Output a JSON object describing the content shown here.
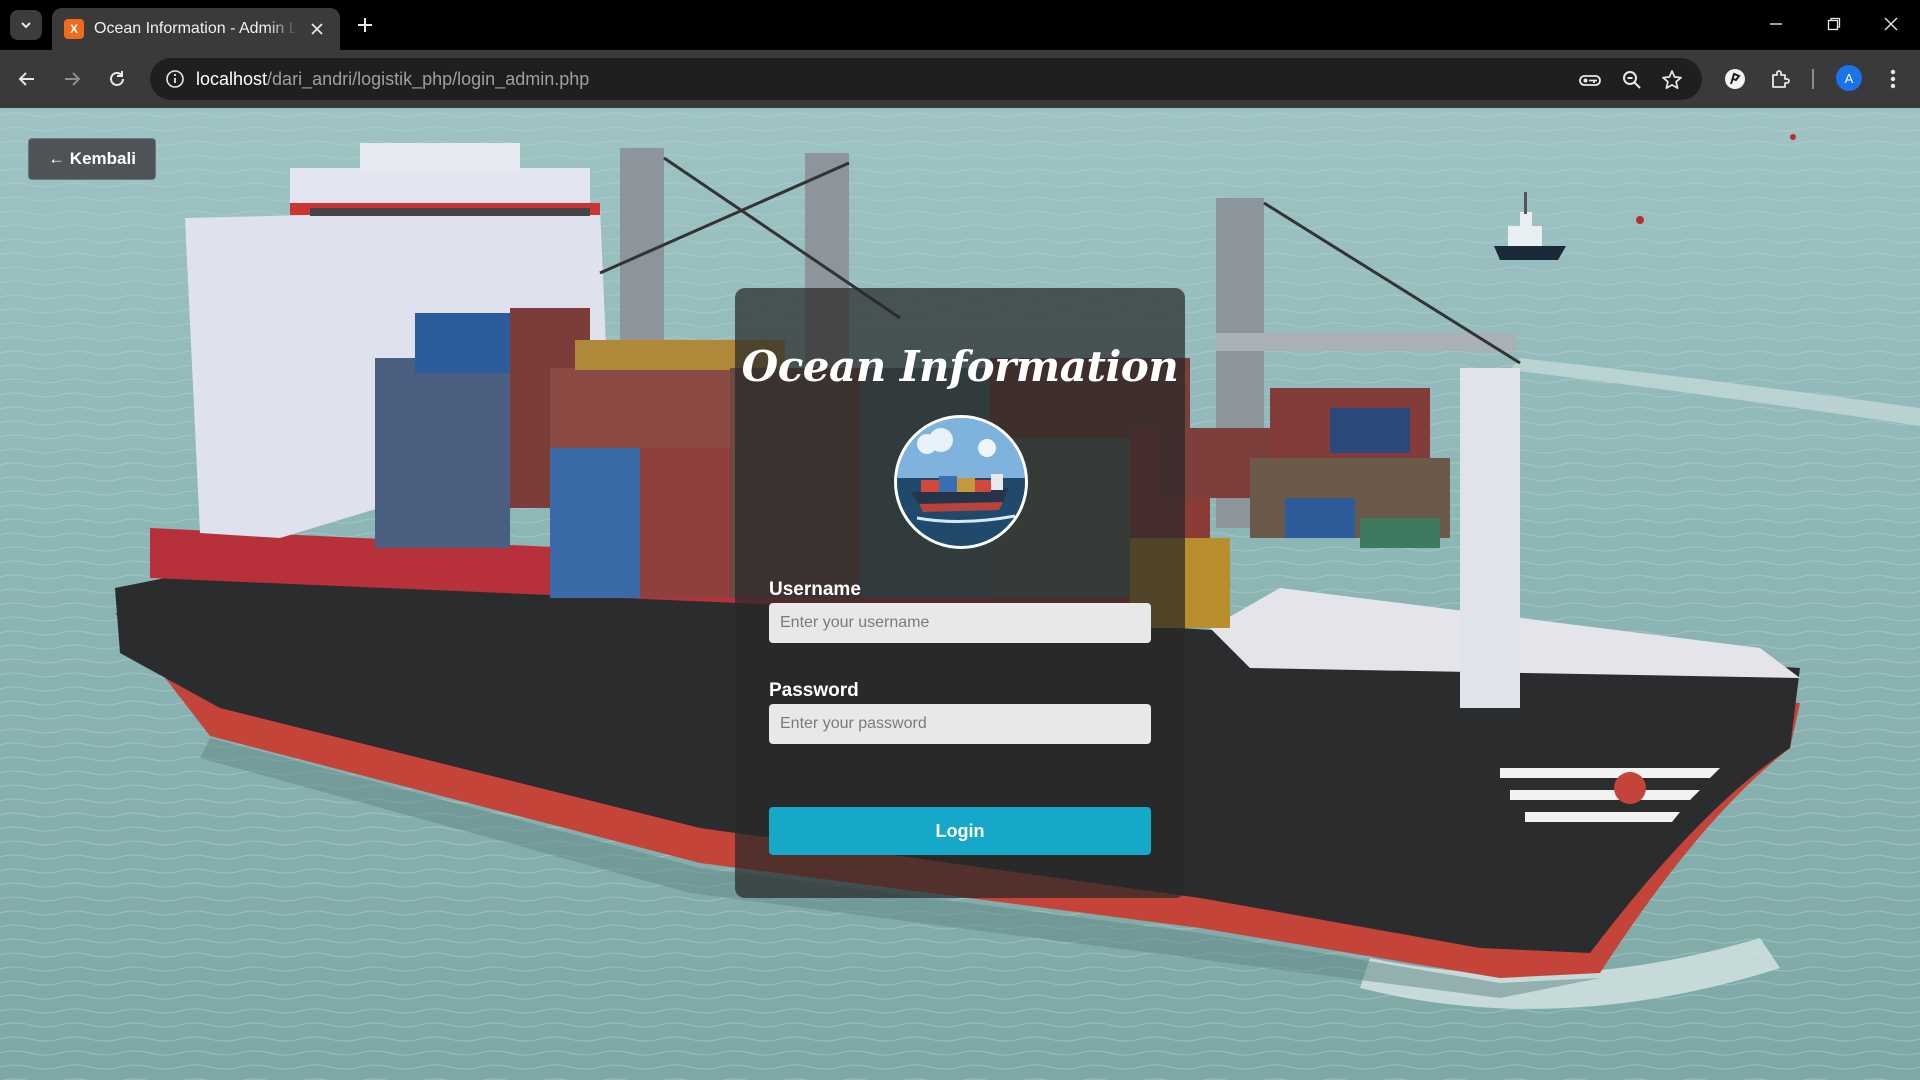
{
  "browser": {
    "tab_title": "Ocean Information - Admin Login",
    "favicon_letter": "X",
    "url_host": "localhost",
    "url_path": "/dari_andri/logistik_php/login_admin.php",
    "profile_initial": "A",
    "icons": {
      "tab_search": "chevron-down-icon",
      "close_tab": "close-icon",
      "new_tab": "plus-icon",
      "minimize": "minimize-icon",
      "restore": "restore-icon",
      "close_window": "close-icon",
      "back": "arrow-left-icon",
      "forward": "arrow-right-icon",
      "reload": "reload-icon",
      "site_info": "info-icon",
      "password": "key-icon",
      "zoom": "zoom-icon",
      "bookmark": "star-icon",
      "extension_app": "extension-app-icon",
      "extensions": "puzzle-icon",
      "menu": "kebab-menu-icon"
    }
  },
  "page": {
    "back_button": "← Kembali",
    "title": "Ocean Information",
    "logo": "ship-logo",
    "username_label": "Username",
    "username_placeholder": "Enter your username",
    "password_label": "Password",
    "password_placeholder": "Enter your password",
    "login_button": "Login",
    "background_image": "container-ship-photo"
  },
  "colors": {
    "login_button": "#15a8c8",
    "chrome_bg": "#3a3a3a",
    "tab_favicon": "#f26b1d",
    "avatar": "#1a73e8"
  }
}
